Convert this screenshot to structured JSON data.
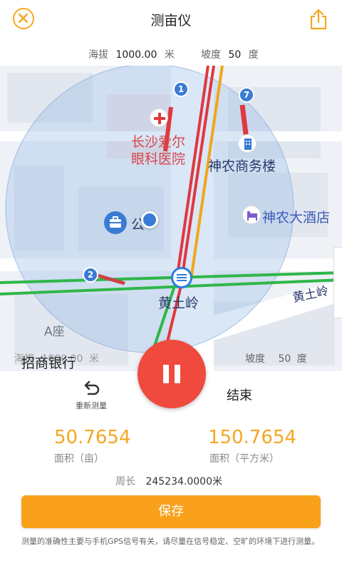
{
  "header": {
    "title": "测亩仪"
  },
  "info": {
    "altitude_label": "海拔",
    "altitude_value": "1000.00",
    "altitude_unit": "米",
    "slope_label": "坡度",
    "slope_value": "50",
    "slope_unit": "度"
  },
  "map": {
    "labels": {
      "hospital_line1": "长沙爱尔",
      "hospital_line2": "眼科医院",
      "office": "神农商务楼",
      "hotel": "神农大酒店",
      "station": "黄土岭",
      "road": "黄土岭",
      "building_a": "A座",
      "bank": "招商银行",
      "partial": "公"
    },
    "pins": [
      "1",
      "7",
      "2"
    ],
    "overlay": {
      "altitude_label": "海拔",
      "altitude_value": "1000.00",
      "altitude_unit": "米",
      "slope_label": "坡度",
      "slope_value": "50",
      "slope_unit": "度"
    }
  },
  "controls": {
    "restart_label": "重新测量",
    "end_label": "结束"
  },
  "stats": {
    "area_mu_value": "50.7654",
    "area_mu_label": "面积（亩）",
    "area_sqm_value": "150.7654",
    "area_sqm_label": "面积（平方米）",
    "perimeter_label": "周长",
    "perimeter_value": "245234.0000米"
  },
  "save_label": "保存",
  "note": "测量的准确性主要与手机GPS信号有关，请尽量在信号稳定、空旷的环境下进行测量。",
  "colors": {
    "accent": "#f9a11b",
    "pause": "#f0493e"
  }
}
